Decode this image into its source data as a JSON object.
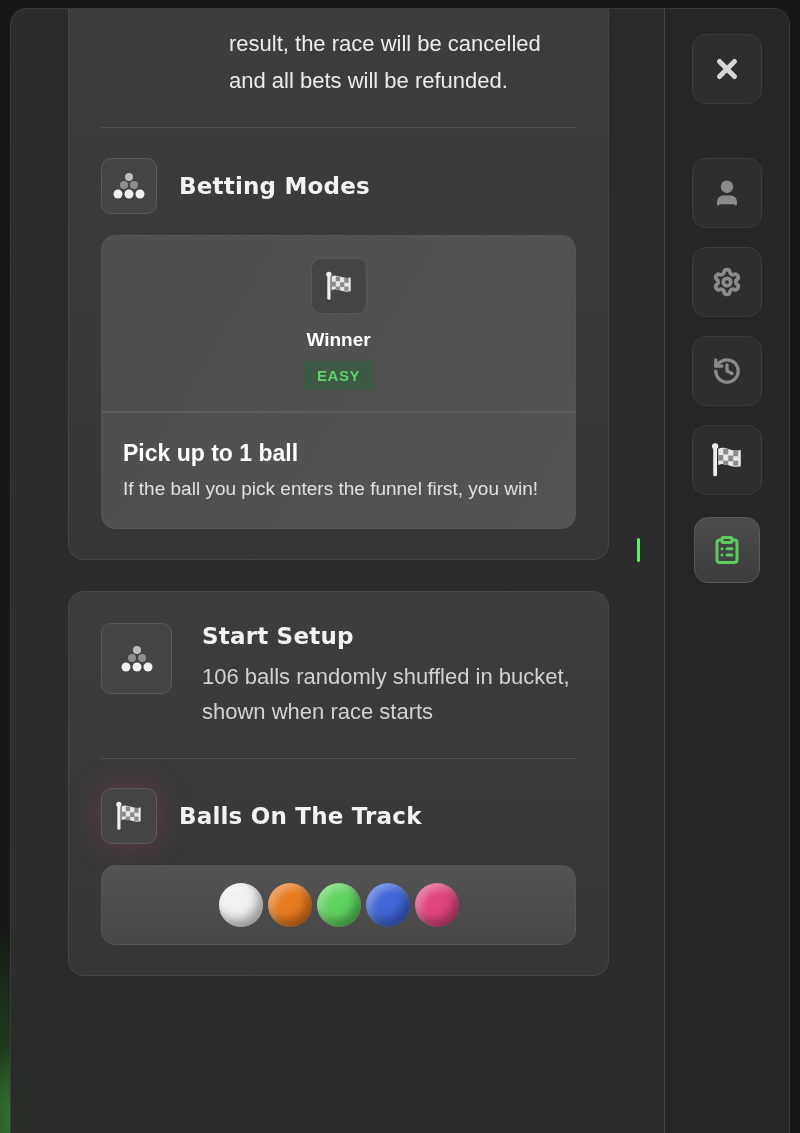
{
  "rules_card": {
    "paragraph": "result, the race will be cancelled and all bets will be refunded."
  },
  "betting_modes": {
    "title": "Betting Modes",
    "modes": [
      {
        "name": "Winner",
        "difficulty": "EASY",
        "heading": "Pick up to 1 ball",
        "description": "If the ball you pick enters the funnel first, you win!"
      }
    ]
  },
  "start_setup": {
    "title": "Start Setup",
    "description": "106 balls randomly shuffled in bucket, shown when race starts"
  },
  "track": {
    "title": "Balls On The Track",
    "balls": [
      {
        "color": "#f0f0f0"
      },
      {
        "color": "#e87a1e"
      },
      {
        "color": "#5fd35f"
      },
      {
        "color": "#3f66d8"
      },
      {
        "color": "#e0457f"
      }
    ]
  },
  "sidebar": {
    "buttons": [
      {
        "kind": "close",
        "selected": false
      },
      {
        "kind": "profile",
        "selected": false
      },
      {
        "kind": "settings",
        "selected": false
      },
      {
        "kind": "history",
        "selected": false
      },
      {
        "kind": "race",
        "selected": false
      },
      {
        "kind": "rules",
        "selected": true
      }
    ]
  }
}
